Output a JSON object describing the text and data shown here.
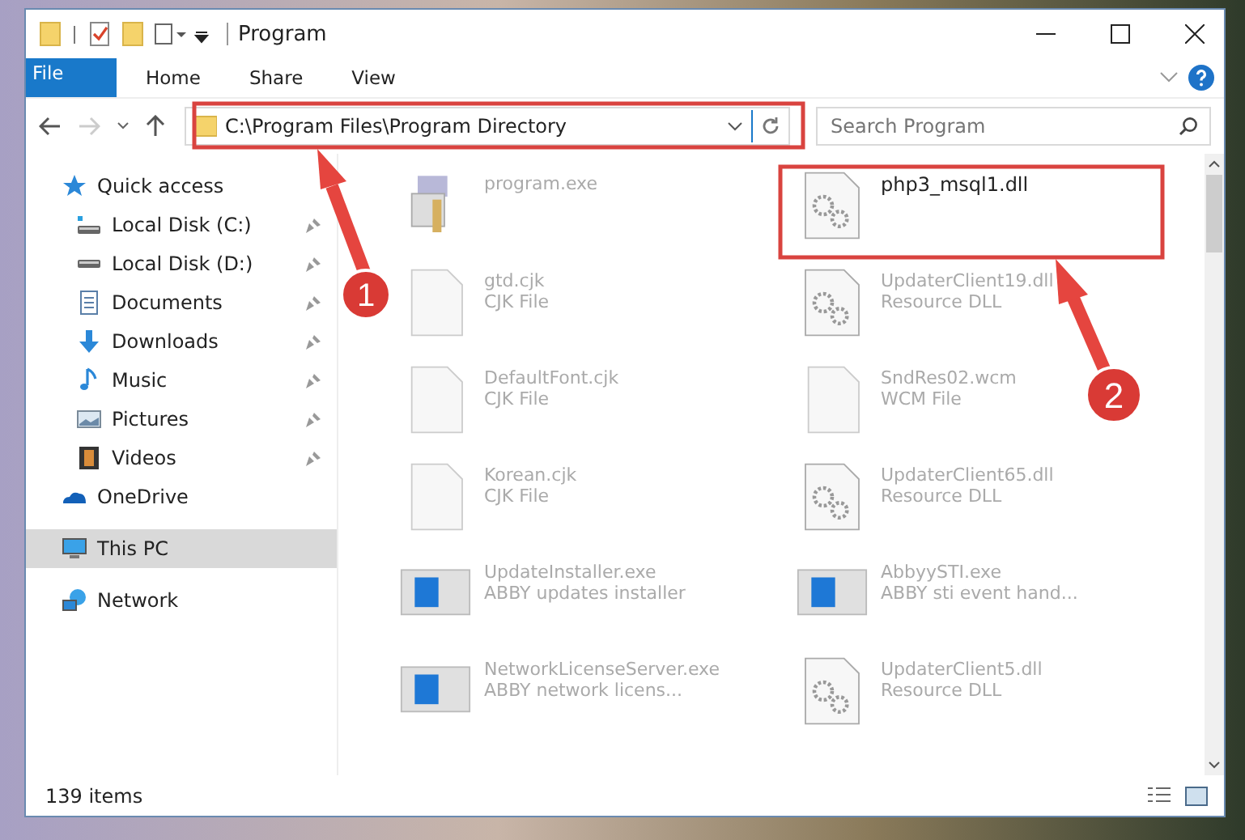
{
  "window": {
    "title": "Program"
  },
  "ribbon": {
    "tabs": [
      {
        "label": "File",
        "kind": "file"
      },
      {
        "label": "Home",
        "kind": "tab"
      },
      {
        "label": "Share",
        "kind": "tab"
      },
      {
        "label": "View",
        "kind": "tab"
      }
    ]
  },
  "address_bar": {
    "path": "C:\\Program Files\\Program Directory"
  },
  "search": {
    "placeholder": "Search Program"
  },
  "sidebar": {
    "items": [
      {
        "label": "Quick access",
        "kind": "star",
        "selected": false,
        "children": [
          {
            "label": "Local Disk (C:)",
            "kind": "disk-win",
            "pinned": true
          },
          {
            "label": "Local Disk (D:)",
            "kind": "disk",
            "pinned": true
          },
          {
            "label": "Documents",
            "kind": "document",
            "pinned": true
          },
          {
            "label": "Downloads",
            "kind": "download",
            "pinned": true
          },
          {
            "label": "Music",
            "kind": "music",
            "pinned": true
          },
          {
            "label": "Pictures",
            "kind": "picture",
            "pinned": true
          },
          {
            "label": "Videos",
            "kind": "video",
            "pinned": true
          }
        ]
      },
      {
        "label": "OneDrive",
        "kind": "cloud",
        "selected": false
      },
      {
        "label": "This PC",
        "kind": "pc",
        "selected": true
      },
      {
        "label": "Network",
        "kind": "network",
        "selected": false
      }
    ]
  },
  "files": [
    {
      "name": "program.exe",
      "kind": "app",
      "highlighted": false
    },
    {
      "name": "php3_msql1.dll",
      "kind": "dll",
      "highlighted": true
    },
    {
      "name": "gtd.cjk",
      "type": "CJK File",
      "kind": "blank",
      "highlighted": false
    },
    {
      "name": "UpdaterClient19.dll",
      "type": "Resource DLL",
      "kind": "dll",
      "highlighted": false
    },
    {
      "name": "DefaultFont.cjk",
      "type": "CJK File",
      "kind": "blank",
      "highlighted": false
    },
    {
      "name": "SndRes02.wcm",
      "type": "WCM File",
      "kind": "blank",
      "highlighted": false
    },
    {
      "name": "Korean.cjk",
      "type": "CJK File",
      "kind": "blank",
      "highlighted": false
    },
    {
      "name": "UpdaterClient65.dll",
      "type": "Resource DLL",
      "kind": "dll",
      "highlighted": false
    },
    {
      "name": "UpdateInstaller.exe",
      "type": "ABBY updates installer",
      "kind": "window",
      "highlighted": false
    },
    {
      "name": "AbbyySTI.exe",
      "type": "ABBY sti event hand...",
      "kind": "window",
      "highlighted": false
    },
    {
      "name": "NetworkLicenseServer.exe",
      "type": "ABBY network licens...",
      "kind": "window",
      "highlighted": false
    },
    {
      "name": "UpdaterClient5.dll",
      "type": "Resource DLL",
      "kind": "dll",
      "highlighted": false
    }
  ],
  "annotations": [
    {
      "number": "1"
    },
    {
      "number": "2"
    }
  ],
  "status_bar": {
    "count": "139 items"
  }
}
